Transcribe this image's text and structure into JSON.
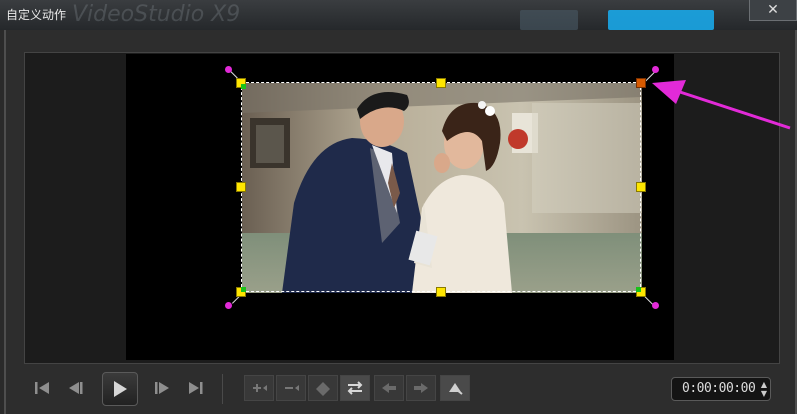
{
  "window": {
    "title": "自定义动作",
    "background_text": "VideoStudio X9",
    "close_label": "✕"
  },
  "timecode": {
    "value": "0:00:00:00"
  },
  "colors": {
    "handle": "#ffe600",
    "active_handle": "#d75a00",
    "rotation_handle": "#e22ad8",
    "annotation_arrow": "#e22ad8"
  },
  "player_controls": [
    "home-icon",
    "prev-frame-icon",
    "play-icon",
    "next-frame-icon",
    "end-icon"
  ],
  "edit_tools": [
    "add-keyframe-icon",
    "remove-keyframe-icon",
    "reverse-icon",
    "swap-keyframe-icon",
    "move-left-icon",
    "move-right-icon",
    "goto-keyframe-icon"
  ]
}
